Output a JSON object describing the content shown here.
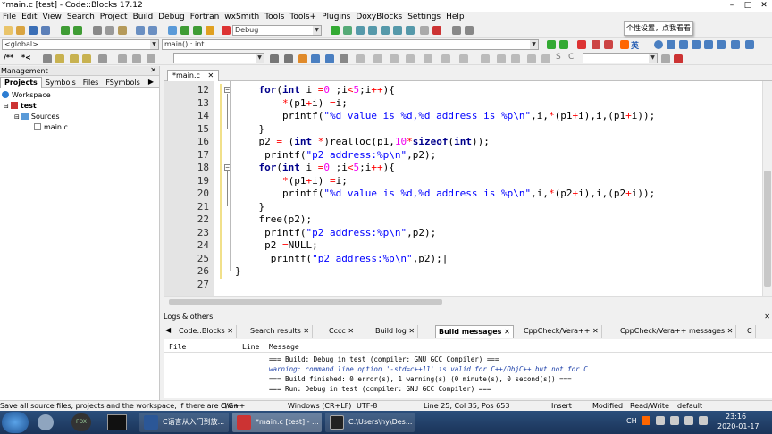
{
  "window": {
    "title": "*main.c [test] - Code::Blocks 17.12"
  },
  "menu": [
    "File",
    "Edit",
    "View",
    "Search",
    "Project",
    "Build",
    "Debug",
    "Fortran",
    "wxSmith",
    "Tools",
    "Tools+",
    "Plugins",
    "DoxyBlocks",
    "Settings",
    "Help"
  ],
  "toolbar": {
    "build_target": "Debug",
    "scope": "<global>",
    "function": "main() : int"
  },
  "tooltip": "个性设置，点我看看",
  "management": {
    "title": "Management",
    "tabs": [
      "Projects",
      "Symbols",
      "Files",
      "FSymbols"
    ],
    "active_tab": "Projects",
    "tree": [
      "Workspace",
      "test",
      "Sources",
      "main.c"
    ]
  },
  "editor": {
    "tab": "*main.c",
    "line_numbers": [
      "12",
      "13",
      "14",
      "15",
      "16",
      "17",
      "18",
      "19",
      "20",
      "21",
      "22",
      "23",
      "24",
      "25",
      "26",
      "27"
    ]
  },
  "logs": {
    "title": "Logs & others",
    "tabs": [
      "Code::Blocks",
      "Search results",
      "Cccc",
      "Build log",
      "Build messages",
      "CppCheck/Vera++",
      "CppCheck/Vera++ messages",
      "C"
    ],
    "active_tab": "Build messages",
    "columns": [
      "File",
      "Line",
      "Message"
    ],
    "messages": [
      "=== Build: Debug in test (compiler: GNU GCC Compiler) ===",
      "warning: command line option '-std=c++11' is valid for C++/ObjC++ but not for C",
      "=== Build finished: 0 error(s), 1 warning(s) (0 minute(s), 0 second(s)) ===",
      "=== Run: Debug in test (compiler: GNU GCC Compiler) ==="
    ]
  },
  "status": {
    "hint": "Save all source files, projects and the workspace, if there are chan",
    "language": "C/C++",
    "eol": "Windows (CR+LF)",
    "encoding": "UTF-8",
    "position": "Line 25, Col 35, Pos 653",
    "mode": "Insert",
    "modified": "Modified",
    "access": "Read/Write",
    "profile": "default"
  },
  "taskbar": {
    "items": [
      "C语言从入门到放...",
      "*main.c [test] - ...",
      "C:\\Users\\hy\\Des..."
    ],
    "ime": "CH",
    "time": "23:16",
    "date": "2020-01-17"
  },
  "colors": {
    "keyword": "#00008b",
    "string": "#0000ff",
    "number": "#f000f0",
    "operator": "#ff0000"
  }
}
